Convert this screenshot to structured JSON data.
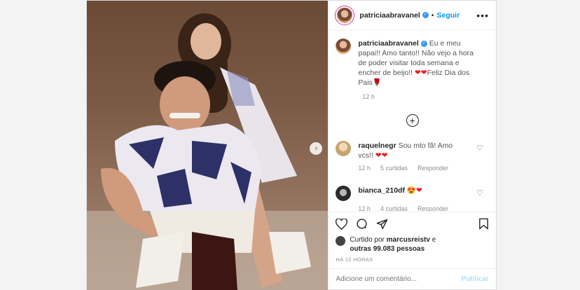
{
  "post": {
    "username": "patriciaabravanel",
    "follow_label": "Seguir",
    "more_label": "•••",
    "caption_text": "Eu e meu papai!! Amo tanto!! Não vejo a hora de poder visitar toda semana e encher de beijo!! ",
    "caption_hearts": "❤❤",
    "caption_tail": "Feliz Dia dos Pais",
    "caption_end_icon": "🌹",
    "timestamp": "12 h"
  },
  "comments": [
    {
      "username": "raquelnegr",
      "text": "Sou mto fã! Amo vcs!! ",
      "emoji": "❤❤",
      "time": "12 h",
      "likes": "5 curtidas",
      "reply": "Responder"
    },
    {
      "username": "bianca_210df",
      "text": "",
      "emoji": "😍❤",
      "time": "12 h",
      "likes": "4 curtidas",
      "reply": "Responder"
    }
  ],
  "likes": {
    "prefix": "Curtido por ",
    "user": "marcusreistv",
    "mid": " e",
    "others": "outras 99.083 pessoas"
  },
  "posted_ago": "HÁ 12 HORAS",
  "add_comment": {
    "placeholder": "Adicione um comentário...",
    "publish_label": "Publicar"
  },
  "colors": {
    "accent": "#0095f6",
    "verified": "#3897f0",
    "heart": "#ed1c24"
  }
}
